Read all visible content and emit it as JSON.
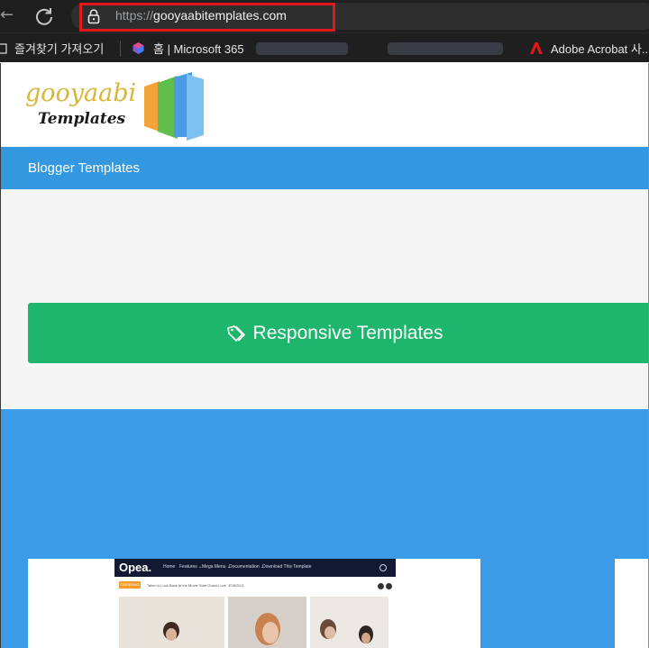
{
  "browser": {
    "url_scheme": "https://",
    "url_host": "gooyaabitemplates.com",
    "highlight_color": "#e3161c",
    "bookmarks": [
      {
        "label": "즐겨찾기 가져오기",
        "icon": "import-favorites-icon"
      },
      {
        "label": "홈 | Microsoft 365",
        "icon": "microsoft-365-icon"
      },
      {
        "label": "Adobe Acrobat 사...",
        "icon": "adobe-acrobat-icon"
      }
    ]
  },
  "site": {
    "logo_word1": "gooyaabi",
    "logo_word2": "Templates",
    "nav_link": "Blogger Templates",
    "cta_label": "Responsive Templates",
    "colors": {
      "nav": "#3498e0",
      "cta": "#1db66c",
      "showcase": "#3b9be6"
    }
  },
  "preview": {
    "brand": "Opea.",
    "menu": [
      "Home",
      "Features ⌄",
      "Mega Menu ⌄",
      "Documentation ⌄",
      "Download This Template"
    ],
    "ticker_label": "TRENDING",
    "ticker_text": "Taken a Look Back at the Movie Start Guest Love",
    "ticker_date": "30/8/2021"
  }
}
